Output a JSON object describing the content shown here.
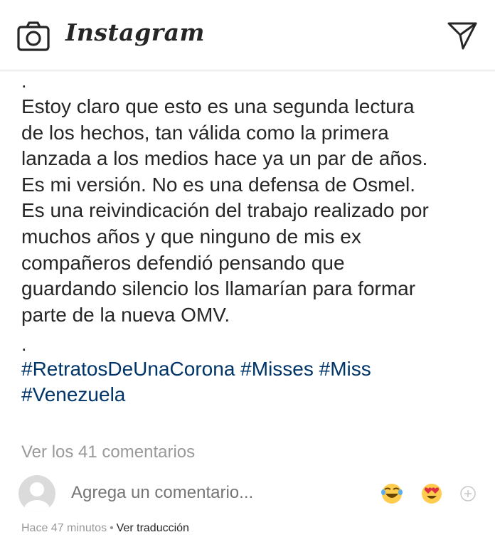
{
  "header": {
    "brand": "Instagram",
    "camera_icon": "camera-icon",
    "direct_icon": "direct-send-icon"
  },
  "post": {
    "dot_top": ".",
    "caption_lines": [
      "Estoy claro que esto es una segunda lectura",
      "de los hechos, tan válida como la primera",
      "lanzada a los medios hace ya un par de años.",
      "Es mi versión. No es una defensa de Osmel.",
      "Es una reivindicación del trabajo realizado por",
      "muchos años y que ninguno de mis ex",
      "compañeros defendió pensando que",
      "guardando silencio los llamarían para formar",
      "parte de la nueva OMV."
    ],
    "dot_bottom": ".",
    "hashtags": [
      "#RetratosDeUnaCorona",
      "#Misses",
      "#Miss",
      "#Venezuela"
    ]
  },
  "comments": {
    "view_all": "Ver los 41 comentarios",
    "placeholder": "Agrega un comentario...",
    "quick_reactions": [
      "joy-emoji",
      "heart-eyes-emoji"
    ],
    "add_icon": "plus-circle-icon"
  },
  "meta": {
    "timestamp": "Hace 47 minutos",
    "separator": "•",
    "translate": "Ver traducción"
  },
  "colors": {
    "text": "#262626",
    "hashtag": "#003569",
    "muted": "#999999",
    "avatar": "#dbdbdb",
    "emoji_face": "#FFCC4D"
  }
}
